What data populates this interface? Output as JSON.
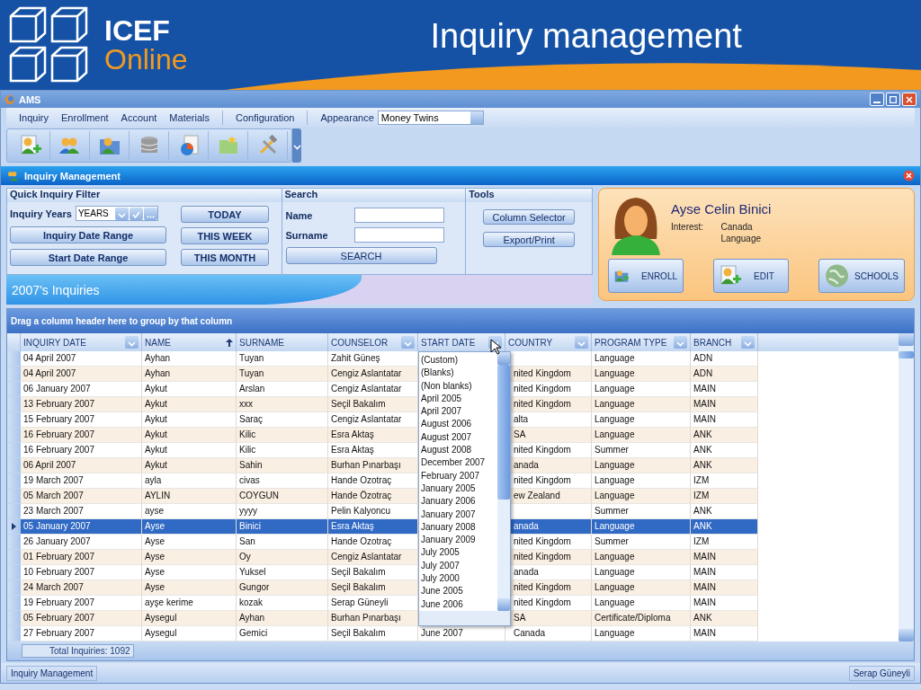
{
  "banner": {
    "brand_top": "ICEF",
    "brand_bottom": "Online",
    "title": "Inquiry management"
  },
  "window": {
    "title": "AMS"
  },
  "menu": {
    "items": [
      "Inquiry",
      "Enrollment",
      "Account",
      "Materials",
      "Configuration"
    ],
    "appearance_label": "Appearance",
    "appearance_value": "Money Twins"
  },
  "panel": {
    "title": "Inquiry Management"
  },
  "quick_filter": {
    "title": "Quick Inquiry Filter",
    "years_label": "Inquiry Years",
    "years_value": "YEARS",
    "range_buttons": [
      "Inquiry Date Range",
      "Start Date Range"
    ],
    "period_buttons": [
      "TODAY",
      "THIS WEEK",
      "THIS MONTH"
    ]
  },
  "search": {
    "title": "Search",
    "fields": [
      {
        "label": "Name"
      },
      {
        "label": "Surname"
      }
    ],
    "button": "SEARCH"
  },
  "tools": {
    "title": "Tools",
    "buttons": [
      "Column Selector",
      "Export/Print"
    ]
  },
  "band": {
    "title": "2007's Inquiries"
  },
  "profile": {
    "name": "Ayse Celin Binici",
    "interest_label": "Interest:",
    "interests": [
      "Canada",
      "Language"
    ],
    "buttons": [
      "ENROLL",
      "EDIT",
      "SCHOOLS"
    ]
  },
  "grid": {
    "group_hint": "Drag a column header here to group by that column",
    "columns": [
      {
        "label": "INQUIRY DATE",
        "kind": "filter"
      },
      {
        "label": "NAME",
        "kind": "sort"
      },
      {
        "label": "SURNAME",
        "kind": "plain"
      },
      {
        "label": "COUNSELOR",
        "kind": "filter"
      },
      {
        "label": "START DATE",
        "kind": "filter"
      },
      {
        "label": "COUNTRY",
        "kind": "filter"
      },
      {
        "label": "PROGRAM TYPE",
        "kind": "filter"
      },
      {
        "label": "BRANCH",
        "kind": "filter"
      }
    ],
    "rows": [
      {
        "cells": [
          "04 April 2007",
          "Ayhan",
          "Tuyan",
          "Zahit Güneş",
          "",
          "",
          "Language",
          "ADN"
        ],
        "selected": false
      },
      {
        "cells": [
          "04 April 2007",
          "Ayhan",
          "Tuyan",
          "Cengiz Aslantatar",
          "",
          "nited Kingdom",
          "Language",
          "ADN"
        ],
        "selected": false
      },
      {
        "cells": [
          "06 January 2007",
          "Aykut",
          "Arslan",
          "Cengiz Aslantatar",
          "",
          "nited Kingdom",
          "Language",
          "MAIN"
        ],
        "selected": false
      },
      {
        "cells": [
          "13 February 2007",
          "Aykut",
          "xxx",
          "Seçil Bakalım",
          "",
          "nited Kingdom",
          "Language",
          "MAIN"
        ],
        "selected": false
      },
      {
        "cells": [
          "15 February 2007",
          "Aykut",
          "Saraç",
          "Cengiz Aslantatar",
          "",
          "alta",
          "Language",
          "MAIN"
        ],
        "selected": false
      },
      {
        "cells": [
          "16 February 2007",
          "Aykut",
          "Kilic",
          "Esra Aktaş",
          "",
          "SA",
          "Language",
          "ANK"
        ],
        "selected": false
      },
      {
        "cells": [
          "16 February 2007",
          "Aykut",
          "Kilic",
          "Esra Aktaş",
          "",
          "nited Kingdom",
          "Summer",
          "ANK"
        ],
        "selected": false
      },
      {
        "cells": [
          "06 April 2007",
          "Aykut",
          "Sahin",
          "Burhan Pınarbaşı",
          "",
          "anada",
          "Language",
          "ANK"
        ],
        "selected": false
      },
      {
        "cells": [
          "19 March 2007",
          "ayla",
          "civas",
          "Hande Ozotraç",
          "",
          "nited Kingdom",
          "Language",
          "IZM"
        ],
        "selected": false
      },
      {
        "cells": [
          "05 March 2007",
          "AYLIN",
          "COYGUN",
          "Hande Özotraç",
          "",
          "ew Zealand",
          "Language",
          "IZM"
        ],
        "selected": false
      },
      {
        "cells": [
          "23 March 2007",
          "ayse",
          "yyyy",
          "Pelin Kalyoncu",
          "",
          "",
          "Summer",
          "ANK"
        ],
        "selected": false
      },
      {
        "cells": [
          "05 January 2007",
          "Ayse",
          "Binici",
          "Esra Aktaş",
          "",
          "anada",
          "Language",
          "ANK"
        ],
        "selected": true
      },
      {
        "cells": [
          "26 January 2007",
          "Ayse",
          "San",
          "Hande Ozotraç",
          "",
          "nited Kingdom",
          "Summer",
          "IZM"
        ],
        "selected": false
      },
      {
        "cells": [
          "01 February 2007",
          "Ayse",
          "Oy",
          "Cengiz Aslantatar",
          "",
          "nited Kingdom",
          "Language",
          "MAIN"
        ],
        "selected": false
      },
      {
        "cells": [
          "10 February 2007",
          "Ayse",
          "Yuksel",
          "Seçil Bakalım",
          "",
          "anada",
          "Language",
          "MAIN"
        ],
        "selected": false
      },
      {
        "cells": [
          "24 March 2007",
          "Ayse",
          "Gungor",
          "Seçil Bakalım",
          "",
          "nited Kingdom",
          "Language",
          "MAIN"
        ],
        "selected": false
      },
      {
        "cells": [
          "19 February 2007",
          "ayşe kerime",
          "kozak",
          "Serap Güneyli",
          "",
          "nited Kingdom",
          "Language",
          "MAIN"
        ],
        "selected": false
      },
      {
        "cells": [
          "05 February 2007",
          "Aysegul",
          "Ayhan",
          "Burhan Pınarbaşı",
          "",
          "SA",
          "Certificate/Diploma",
          "ANK"
        ],
        "selected": false
      },
      {
        "cells": [
          "27 February 2007",
          "Aysegul",
          "Gemici",
          "Seçil Bakalım",
          "June 2007",
          "Canada",
          "Language",
          "MAIN"
        ],
        "selected": false
      }
    ],
    "filter_dropdown": {
      "items": [
        "(Custom)",
        "(Blanks)",
        "(Non blanks)",
        "April 2005",
        "April 2007",
        "August 2006",
        "August 2007",
        "August 2008",
        "December 2007",
        "February 2007",
        "January 2005",
        "January 2006",
        "January 2007",
        "January 2008",
        "January 2009",
        "July 2005",
        "July 2007",
        "July 2000",
        "June 2005",
        "June 2006"
      ]
    },
    "total": "Total Inquiries: 1092"
  },
  "status_bar": {
    "left": "Inquiry Management",
    "right": "Serap Güneyli"
  }
}
